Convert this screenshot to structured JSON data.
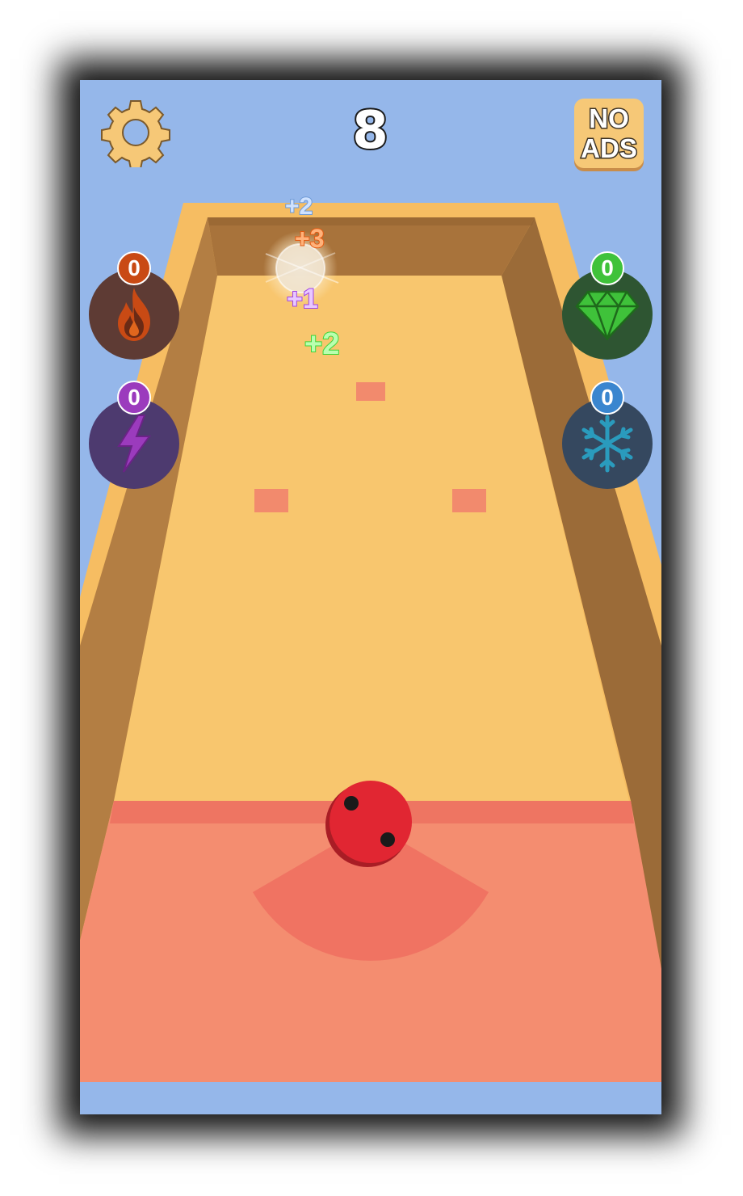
{
  "hud": {
    "score": "8",
    "no_ads_line1": "NO",
    "no_ads_line2": "ADS"
  },
  "powerups": {
    "fire": {
      "count": "0",
      "icon": "fire-icon",
      "color": "#c94a14"
    },
    "lightning": {
      "count": "0",
      "icon": "lightning-icon",
      "color": "#9b3bbd"
    },
    "gem": {
      "count": "0",
      "icon": "diamond-icon",
      "color": "#3fc23a"
    },
    "freeze": {
      "count": "0",
      "icon": "snowflake-icon",
      "color": "#3a86cf"
    }
  },
  "floating_points": [
    "+2",
    "+3",
    "+1",
    "+2"
  ],
  "colors": {
    "sky": "#95b7ea",
    "board": "#f8c66e",
    "floor_zone": "#f48d70",
    "ball": "#e12632"
  }
}
